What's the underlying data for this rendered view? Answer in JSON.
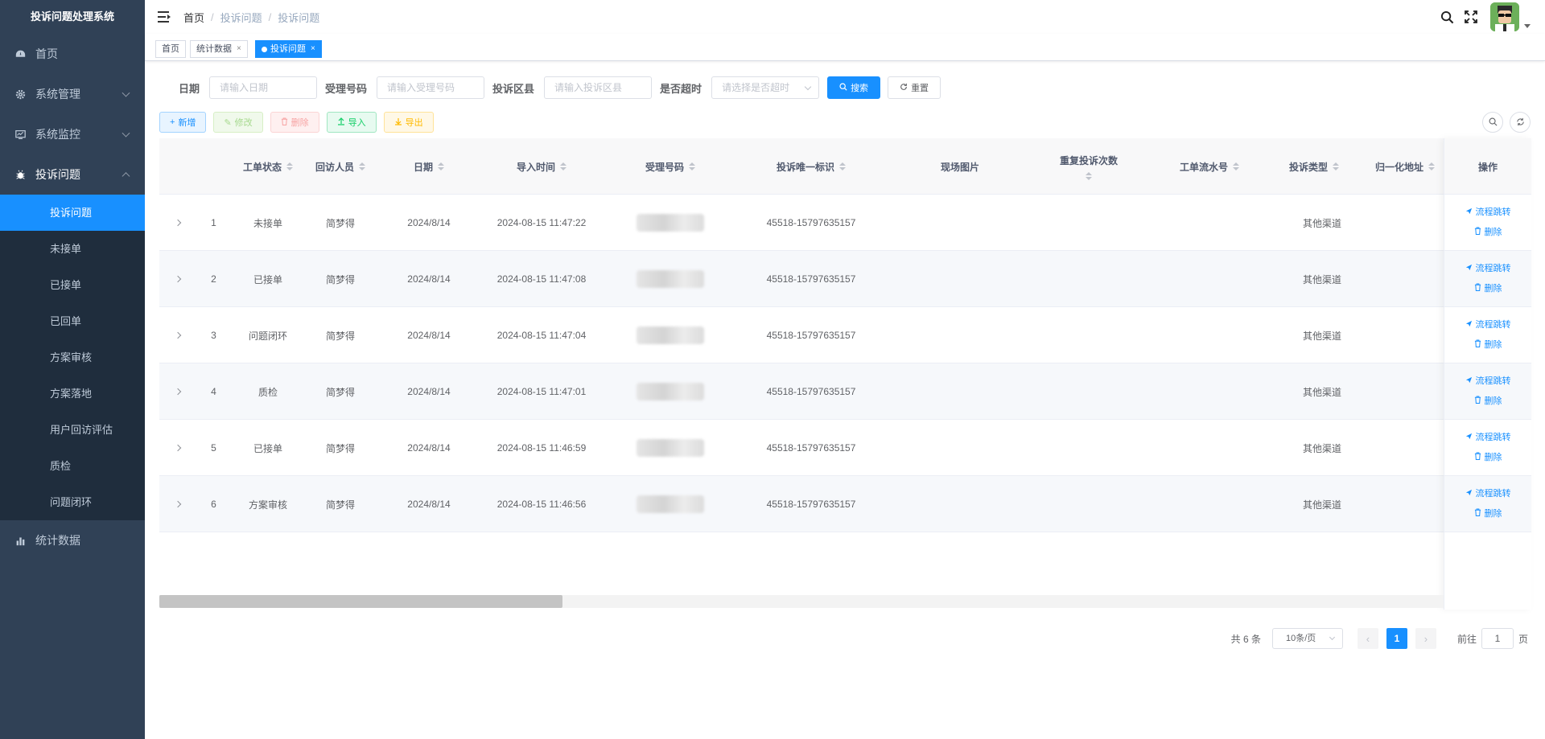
{
  "app": {
    "title": "投诉问题处理系统"
  },
  "sidebar": {
    "items": [
      {
        "label": "首页",
        "icon": "dashboard-icon"
      },
      {
        "label": "系统管理",
        "icon": "gear-icon"
      },
      {
        "label": "系统监控",
        "icon": "monitor-icon"
      },
      {
        "label": "投诉问题",
        "icon": "bug-icon"
      },
      {
        "label": "统计数据",
        "icon": "chart-icon"
      }
    ],
    "sub_items": [
      "投诉问题",
      "未接单",
      "已接单",
      "已回单",
      "方案审核",
      "方案落地",
      "用户回访评估",
      "质检",
      "问题闭环"
    ]
  },
  "breadcrumb": [
    "首页",
    "投诉问题",
    "投诉问题"
  ],
  "tags": [
    {
      "label": "首页"
    },
    {
      "label": "统计数据",
      "close": "×"
    },
    {
      "label": "投诉问题",
      "close": "×"
    }
  ],
  "search": {
    "date_label": "日期",
    "date_placeholder": "请输入日期",
    "accept_label": "受理号码",
    "accept_placeholder": "请输入受理号码",
    "district_label": "投诉区县",
    "district_placeholder": "请输入投诉区县",
    "timeout_label": "是否超时",
    "timeout_placeholder": "请选择是否超时",
    "search_btn": "搜索",
    "reset_btn": "重置"
  },
  "toolbar": {
    "add": "新增",
    "edit": "修改",
    "delete": "删除",
    "import": "导入",
    "export": "导出"
  },
  "table": {
    "headers": [
      "工单状态",
      "回访人员",
      "日期",
      "导入时间",
      "受理号码",
      "投诉唯一标识",
      "现场图片",
      "重复投诉次数",
      "工单流水号",
      "投诉类型",
      "归一化地址",
      "操作"
    ],
    "rows": [
      {
        "index": "1",
        "status": "未接单",
        "visitor": "简梦得",
        "date": "2024/8/14",
        "import_time": "2024-08-15 11:47:22",
        "uid": "45518-15797635157",
        "type": "其他渠道"
      },
      {
        "index": "2",
        "status": "已接单",
        "visitor": "简梦得",
        "date": "2024/8/14",
        "import_time": "2024-08-15 11:47:08",
        "uid": "45518-15797635157",
        "type": "其他渠道"
      },
      {
        "index": "3",
        "status": "问题闭环",
        "visitor": "简梦得",
        "date": "2024/8/14",
        "import_time": "2024-08-15 11:47:04",
        "uid": "45518-15797635157",
        "type": "其他渠道"
      },
      {
        "index": "4",
        "status": "质检",
        "visitor": "简梦得",
        "date": "2024/8/14",
        "import_time": "2024-08-15 11:47:01",
        "uid": "45518-15797635157",
        "type": "其他渠道"
      },
      {
        "index": "5",
        "status": "已接单",
        "visitor": "简梦得",
        "date": "2024/8/14",
        "import_time": "2024-08-15 11:46:59",
        "uid": "45518-15797635157",
        "type": "其他渠道"
      },
      {
        "index": "6",
        "status": "方案审核",
        "visitor": "简梦得",
        "date": "2024/8/14",
        "import_time": "2024-08-15 11:46:56",
        "uid": "45518-15797635157",
        "type": "其他渠道"
      }
    ],
    "op_flow": "流程跳转",
    "op_delete": "删除"
  },
  "pagination": {
    "total": "共 6 条",
    "page_size": "10条/页",
    "current": "1",
    "goto_label": "前往",
    "goto_value": "1",
    "page_suffix": "页"
  },
  "colors": {
    "sidebar": "#304156",
    "submenu": "#1f2d3d",
    "primary": "#1890ff"
  }
}
